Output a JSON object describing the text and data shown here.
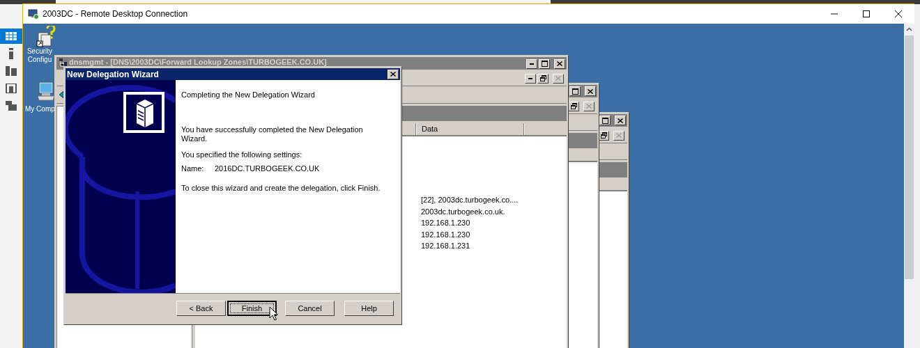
{
  "host_sidebar": {
    "items": [
      {
        "selected": true
      },
      {
        "selected": false
      },
      {
        "selected": false
      },
      {
        "selected": false
      },
      {
        "selected": false
      }
    ]
  },
  "window": {
    "title": "2003DC - Remote Desktop Connection"
  },
  "desktop_icons": [
    {
      "label": "Security Configu"
    },
    {
      "label": "My Comp"
    }
  ],
  "dns_window": {
    "title": "dnsmgmt - [DNS\\2003DC\\Forward Lookup Zones\\TURBOGEEK.CO.UK]",
    "columns": [
      "Data"
    ],
    "rows": [
      "[22], 2003dc.turbogeek.co....",
      "2003dc.turbogeek.co.uk.",
      "192.168.1.230",
      "192.168.1.230",
      "192.168.1.231"
    ]
  },
  "wizard": {
    "title": "New Delegation Wizard",
    "heading": "Completing the New Delegation Wizard",
    "message": "You have successfully completed the New Delegation Wizard.",
    "settings_intro": "You specified the following settings:",
    "settings": [
      {
        "label": "Name:",
        "value": "2016DC.TURBOGEEK.CO.UK"
      }
    ],
    "closing": "To close this wizard and create the delegation, click Finish.",
    "buttons": [
      {
        "label": "< Back",
        "focused": false
      },
      {
        "label": "Finish",
        "focused": true
      },
      {
        "label": "Cancel",
        "focused": false
      },
      {
        "label": "Help",
        "focused": false
      }
    ]
  }
}
